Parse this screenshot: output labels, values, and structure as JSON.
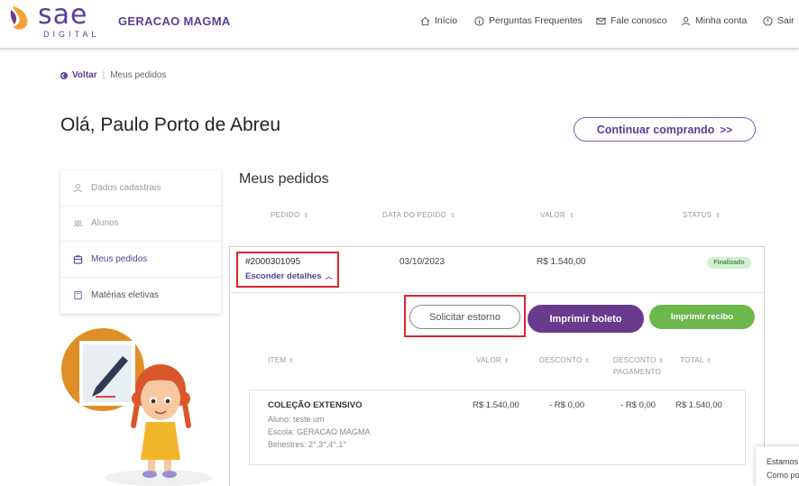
{
  "header": {
    "logo_text": "sae",
    "logo_sub": "DIGITAL",
    "school": "GERACAO MAGMA",
    "nav": [
      {
        "label": "Início",
        "icon": "home-icon"
      },
      {
        "label": "Perguntas Frequentes",
        "icon": "info-icon"
      },
      {
        "label": "Fale conosco",
        "icon": "mail-icon"
      },
      {
        "label": "Minha conta",
        "icon": "user-icon"
      },
      {
        "label": "Sair",
        "icon": "power-icon"
      }
    ]
  },
  "breadcrumb": {
    "back": "Voltar",
    "current": "Meus pedidos"
  },
  "greeting": "Olá, Paulo Porto de Abreu",
  "continue_button": "Continuar comprando",
  "sidebar": {
    "items": [
      {
        "label": "Dados cadastrais",
        "icon": "user-icon"
      },
      {
        "label": "Alunos",
        "icon": "students-icon"
      },
      {
        "label": "Meus pedidos",
        "icon": "bag-icon",
        "active": true
      },
      {
        "label": "Matérias eletivas",
        "icon": "book-icon"
      }
    ]
  },
  "orders": {
    "title": "Meus pedidos",
    "columns": [
      "PEDIDO",
      "DATA DO PEDIDO",
      "VALOR",
      "STATUS"
    ],
    "order": {
      "number": "#2000301095",
      "toggle": "Esconder detalhes",
      "date": "03/10/2023",
      "value": "R$ 1.540,00",
      "status": "Finalizado"
    },
    "buttons": {
      "refund": "Solicitar estorno",
      "print_boleto": "Imprimir boleto",
      "print_receipt": "Imprimir recibo"
    },
    "item_columns": {
      "item": "ITEM",
      "valor": "VALOR",
      "desconto": "DESCONTO",
      "desconto_pag_1": "DESCONTO",
      "desconto_pag_2": "PAGAMENTO",
      "total": "TOTAL"
    },
    "item": {
      "name": "COLEÇÃO EXTENSIVO",
      "aluno": "Aluno: teste um",
      "escola": "Escola: GERACAO MAGMA",
      "bimestres": "Bimestres: 2°,3°,4°,1°",
      "valor": "R$ 1.540,00",
      "desconto": "- R$ 0,00",
      "desconto_pagamento": "- R$ 0,00",
      "total": "R$ 1.540,00"
    }
  },
  "chat": {
    "line1": "Estamos",
    "line2": "Como po"
  },
  "colors": {
    "brand_purple": "#5b3e96",
    "button_purple": "#6a3a8f",
    "green": "#6db84c",
    "highlight_red": "#d9262c"
  }
}
